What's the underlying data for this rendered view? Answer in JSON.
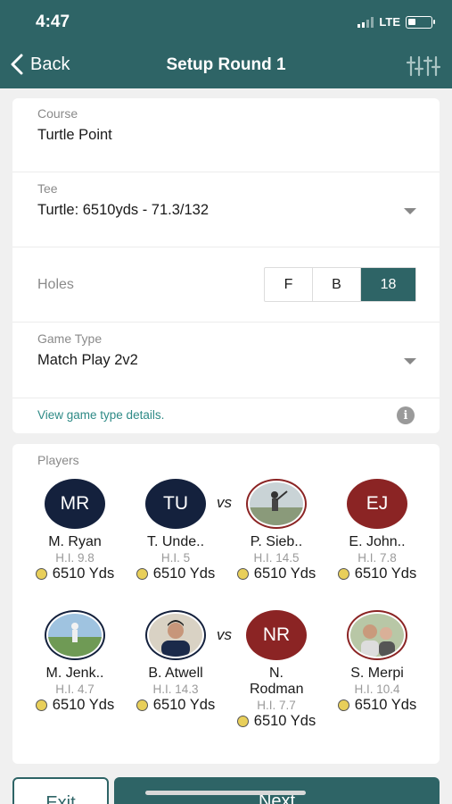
{
  "status": {
    "time": "4:47",
    "network": "LTE"
  },
  "nav": {
    "back_label": "Back",
    "title": "Setup Round 1"
  },
  "course": {
    "label": "Course",
    "value": "Turtle Point"
  },
  "tee": {
    "label": "Tee",
    "value": "Turtle: 6510yds - 71.3/132"
  },
  "holes": {
    "label": "Holes",
    "options": [
      "F",
      "B",
      "18"
    ],
    "selected": "18"
  },
  "game_type": {
    "label": "Game Type",
    "value": "Match Play 2v2",
    "details_link": "View game type details."
  },
  "players": {
    "label": "Players",
    "vs": "vs",
    "list": [
      {
        "initials": "MR",
        "name": "M. Ryan",
        "hi": "H.I. 9.8",
        "yds": "6510 Yds"
      },
      {
        "initials": "TU",
        "name": "T. Unde..",
        "hi": "H.I. 5",
        "yds": "6510 Yds"
      },
      {
        "initials": "",
        "name": "P. Sieb..",
        "hi": "H.I. 14.5",
        "yds": "6510 Yds"
      },
      {
        "initials": "EJ",
        "name": "E. John..",
        "hi": "H.I. 7.8",
        "yds": "6510 Yds"
      },
      {
        "initials": "",
        "name": "M. Jenk..",
        "hi": "H.I. 4.7",
        "yds": "6510 Yds"
      },
      {
        "initials": "",
        "name": "B. Atwell",
        "hi": "H.I. 14.3",
        "yds": "6510 Yds"
      },
      {
        "initials": "NR",
        "name": "N. Rodman",
        "hi": "H.I. 7.7",
        "yds": "6510 Yds"
      },
      {
        "initials": "",
        "name": "S. Merpi",
        "hi": "H.I. 10.4",
        "yds": "6510 Yds"
      }
    ]
  },
  "buttons": {
    "exit": "Exit",
    "next": "Next"
  },
  "colors": {
    "primary": "#2e6466",
    "team_blue": "#14213d",
    "team_red": "#8b2424",
    "link": "#2e8a86",
    "coin": "#e8cf5a"
  }
}
